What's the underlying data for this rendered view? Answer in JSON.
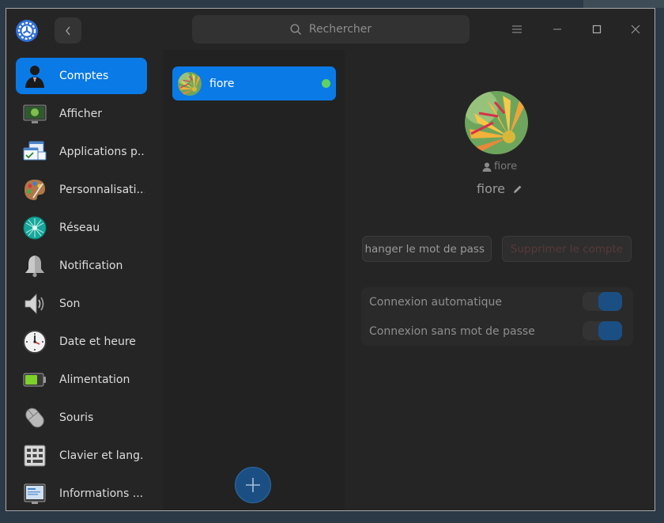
{
  "search": {
    "placeholder": "Rechercher"
  },
  "sidebar": {
    "items": [
      {
        "label": "Comptes",
        "icon": "accounts-icon",
        "active": true
      },
      {
        "label": "Afficher",
        "icon": "display-icon"
      },
      {
        "label": "Applications p...",
        "icon": "default-apps-icon"
      },
      {
        "label": "Personnalisati...",
        "icon": "personalization-icon"
      },
      {
        "label": "Réseau",
        "icon": "network-icon"
      },
      {
        "label": "Notification",
        "icon": "notification-icon"
      },
      {
        "label": "Son",
        "icon": "sound-icon"
      },
      {
        "label": "Date et heure",
        "icon": "clock-icon"
      },
      {
        "label": "Alimentation",
        "icon": "power-icon"
      },
      {
        "label": "Souris",
        "icon": "mouse-icon"
      },
      {
        "label": "Clavier et lang...",
        "icon": "keyboard-icon"
      },
      {
        "label": "Informations ...",
        "icon": "system-info-icon"
      }
    ]
  },
  "users": {
    "items": [
      {
        "name": "fiore",
        "online": true
      }
    ]
  },
  "account": {
    "login_name": "fiore",
    "full_name": "fiore",
    "change_password_label": "hanger le mot de pass",
    "delete_label": "Supprimer le compte",
    "options": [
      {
        "label": "Connexion automatique",
        "enabled": true
      },
      {
        "label": "Connexion sans mot de passe",
        "enabled": true
      }
    ]
  },
  "colors": {
    "accent": "#0a7ae6",
    "online": "#5fd35f",
    "toggle_on": "#1b4f83"
  }
}
